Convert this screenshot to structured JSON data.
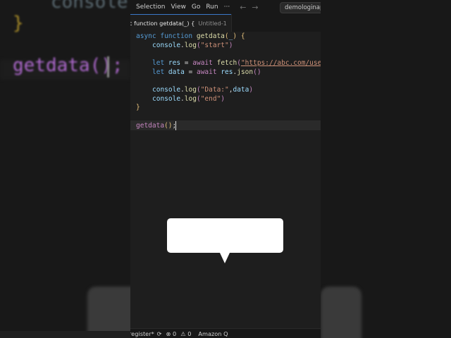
{
  "background": {
    "code_console": "console.",
    "code_brace": "}",
    "code_call": "getdata();"
  },
  "menubar": {
    "items": [
      "Selection",
      "View",
      "Go",
      "Run",
      "···"
    ],
    "command_center": "demologinap"
  },
  "tab": {
    "label": "c function getdata(_) {",
    "sublabel": "Untitled-1",
    "modified_dot": "●"
  },
  "editor": {
    "lines": [
      {
        "async": "async",
        "fn": "function",
        "name": "getdata",
        "lp": "(",
        "param": "_",
        "rp": ")",
        "brace": "{"
      },
      {
        "obj": "console",
        "dot": ".",
        "method": "log",
        "lp": "(",
        "str": "\"start\"",
        "rp": ")"
      },
      {
        "kw": "let",
        "var": "res",
        "eq": " = ",
        "await": "await",
        "call": "fetch",
        "lp": "(",
        "url": "\"https://abc.com/user"
      },
      {
        "kw": "let",
        "var": "data",
        "eq": " = ",
        "await": "await",
        "var2": "res",
        "dot": ".",
        "method": "json",
        "lp": "(",
        "rp": ")"
      },
      {
        "obj": "console",
        "dot": ".",
        "method": "log",
        "lp": "(",
        "str": "\"Data:\"",
        "comma": ",",
        "arg": "data",
        "rp": ")"
      },
      {
        "obj": "console",
        "dot": ".",
        "method": "log",
        "lp": "(",
        "str": "\"end\"",
        "rp": ")"
      },
      {
        "brace": "}"
      },
      {
        "name": "getdata",
        "lp": "(",
        "rp": ")",
        "semi": ";"
      }
    ]
  },
  "statusbar": {
    "branch": "register*",
    "errors": "0",
    "warnings": "0",
    "amazon": "Amazon Q"
  },
  "colors": {
    "editor_bg": "#1e1e1e",
    "keyword": "#569cd6",
    "function": "#dcdcaa",
    "string": "#ce9178",
    "control": "#c586c0",
    "variable": "#9cdcfe",
    "bracket": "#e5c07b"
  }
}
